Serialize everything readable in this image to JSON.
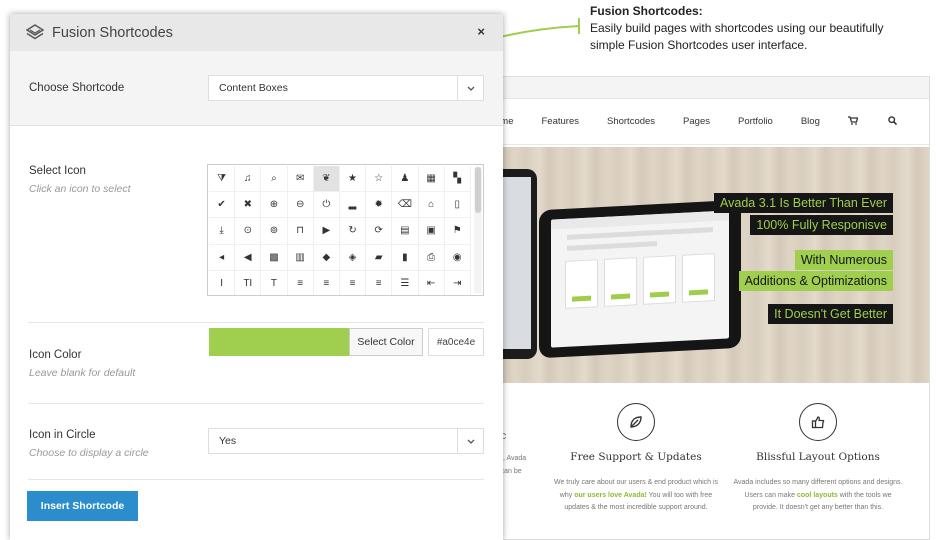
{
  "callout": {
    "title": "Fusion Shortcodes:",
    "text": "Easily build pages with shortcodes using our beautifully simple Fusion Shortcodes user interface.",
    "accent_color": "#a0ce4e"
  },
  "site": {
    "nav": [
      "ome",
      "Features",
      "Shortcodes",
      "Pages",
      "Portfolio",
      "Blog"
    ],
    "nav_icons": [
      "cart-icon",
      "search-icon"
    ],
    "hero_lines": [
      {
        "text": "Avada 3.1 Is Better Than Ever",
        "style": "dark"
      },
      {
        "text": "100% Fully Responisve",
        "style": "dark"
      },
      {
        "text": "With Numerous",
        "style": "green"
      },
      {
        "text": "Additions & Optimizations",
        "style": "green"
      },
      {
        "text": "It Doesn't Get Better",
        "style": "dark"
      }
    ],
    "features": [
      {
        "icon": "leaf-icon",
        "title": "Free Support & Updates",
        "text_parts": [
          "We truly care about our users & end product which is why ",
          "our users love Avada!",
          " You will too with free updates & the most incredible support around."
        ]
      },
      {
        "icon": "thumbs-up-icon",
        "title": "Blissful Layout Options",
        "text_parts": [
          "Avada includes so many different options and designs. Users can make ",
          "cool layouts",
          " with the tools we provide. It doesn't get any better than this."
        ]
      }
    ],
    "partial_feature": {
      "title": "ic",
      "text": "wible, Avada\nand can be\nt be."
    }
  },
  "modal": {
    "title": "Fusion Shortcodes",
    "close": "×",
    "choose": {
      "label": "Choose Shortcode",
      "value": "Content Boxes"
    },
    "select_icon": {
      "label": "Select Icon",
      "hint": "Click an icon to select",
      "icons": [
        {
          "name": "filter-icon",
          "glyph": "⧩"
        },
        {
          "name": "music-icon",
          "glyph": "♫"
        },
        {
          "name": "search-icon",
          "glyph": "⌕"
        },
        {
          "name": "envelope-icon",
          "glyph": "✉"
        },
        {
          "name": "leaf-icon",
          "glyph": "❦",
          "selected": true
        },
        {
          "name": "star-icon",
          "glyph": "★"
        },
        {
          "name": "star-empty-icon",
          "glyph": "☆"
        },
        {
          "name": "user-icon",
          "glyph": "♟"
        },
        {
          "name": "film-icon",
          "glyph": "▦"
        },
        {
          "name": "th-large-icon",
          "glyph": "▚"
        },
        {
          "name": "check-icon",
          "glyph": "✔"
        },
        {
          "name": "remove-icon",
          "glyph": "✖"
        },
        {
          "name": "zoom-in-icon",
          "glyph": "⊕"
        },
        {
          "name": "zoom-out-icon",
          "glyph": "⊖"
        },
        {
          "name": "power-off-icon",
          "glyph": "⏻"
        },
        {
          "name": "signal-icon",
          "glyph": "▂"
        },
        {
          "name": "cog-icon",
          "glyph": "✹"
        },
        {
          "name": "trash-icon",
          "glyph": "⌫"
        },
        {
          "name": "home-icon",
          "glyph": "⌂"
        },
        {
          "name": "file-icon",
          "glyph": "▯"
        },
        {
          "name": "download-icon",
          "glyph": "⤓"
        },
        {
          "name": "arrow-circle-down-icon",
          "glyph": "⊙"
        },
        {
          "name": "arrow-circle-up-icon",
          "glyph": "⊚"
        },
        {
          "name": "inbox-icon",
          "glyph": "⊓"
        },
        {
          "name": "play-circle-icon",
          "glyph": "▶"
        },
        {
          "name": "repeat-icon",
          "glyph": "↻"
        },
        {
          "name": "refresh-icon",
          "glyph": "⟳"
        },
        {
          "name": "list-alt-icon",
          "glyph": "▤"
        },
        {
          "name": "lock-icon",
          "glyph": "▣"
        },
        {
          "name": "flag-icon",
          "glyph": "⚑"
        },
        {
          "name": "volume-down-icon",
          "glyph": "◂"
        },
        {
          "name": "volume-up-icon",
          "glyph": "◀"
        },
        {
          "name": "qrcode-icon",
          "glyph": "▩"
        },
        {
          "name": "barcode-icon",
          "glyph": "▥"
        },
        {
          "name": "tag-icon",
          "glyph": "◆"
        },
        {
          "name": "tags-icon",
          "glyph": "◈"
        },
        {
          "name": "book-icon",
          "glyph": "▰"
        },
        {
          "name": "bookmark-icon",
          "glyph": "▮"
        },
        {
          "name": "print-icon",
          "glyph": "⎙"
        },
        {
          "name": "camera-icon",
          "glyph": "◉"
        },
        {
          "name": "italic-icon",
          "glyph": "I"
        },
        {
          "name": "text-height-icon",
          "glyph": "TI"
        },
        {
          "name": "text-width-icon",
          "glyph": "T"
        },
        {
          "name": "align-left-icon",
          "glyph": "≡"
        },
        {
          "name": "align-center-icon",
          "glyph": "≡"
        },
        {
          "name": "align-right-icon",
          "glyph": "≡"
        },
        {
          "name": "align-justify-icon",
          "glyph": "≡"
        },
        {
          "name": "list-icon",
          "glyph": "☰"
        },
        {
          "name": "outdent-icon",
          "glyph": "⇤"
        },
        {
          "name": "indent-icon",
          "glyph": "⇥"
        }
      ]
    },
    "icon_color": {
      "label": "Icon Color",
      "hint": "Leave blank for default",
      "button": "Select Color",
      "value": "#a0ce4e",
      "swatch_color": "#a0ce4e"
    },
    "icon_circle": {
      "label": "Icon in Circle",
      "hint": "Choose to display a circle",
      "value": "Yes"
    },
    "insert_button": "Insert Shortcode",
    "button_color": "#2b8dcc"
  }
}
